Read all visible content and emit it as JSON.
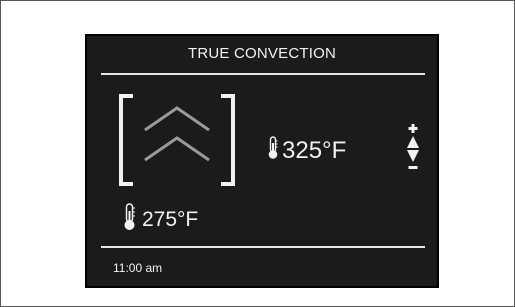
{
  "display": {
    "mode_title": "TRUE CONVECTION",
    "mode_icon": "convection-chevrons-icon",
    "set_temperature": "325°F",
    "current_temperature": "275°F",
    "clock": "11:00 am"
  },
  "icons": {
    "thermometer": "thermometer-icon",
    "increase": "plus-arrow-up-icon",
    "decrease": "minus-arrow-down-icon"
  },
  "colors": {
    "screen_background": "#1b1b1b",
    "foreground": "#f2f2f2",
    "icon_gray": "#9a9a9a"
  }
}
